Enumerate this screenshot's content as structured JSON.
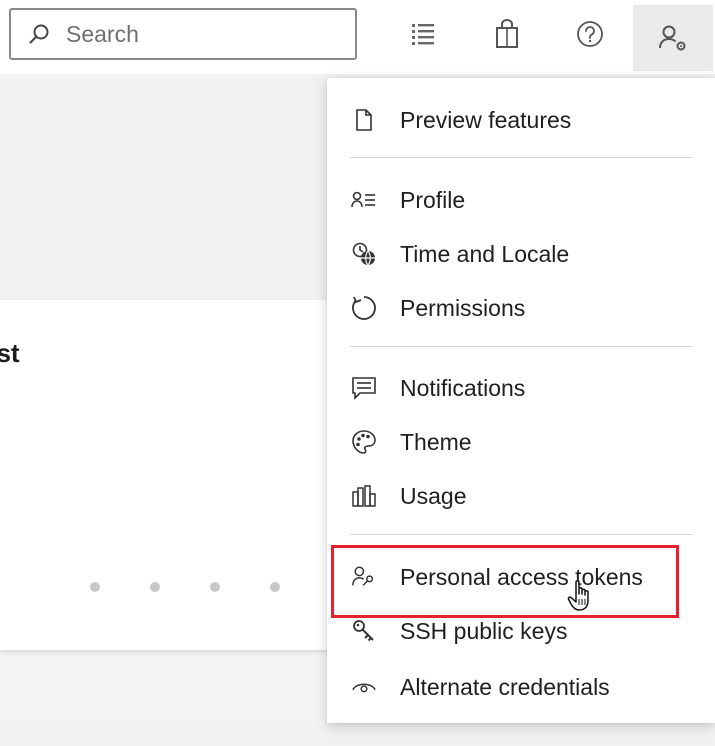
{
  "search": {
    "placeholder": "Search",
    "value": ""
  },
  "header_icons": [
    {
      "name": "list-icon",
      "interactable": true
    },
    {
      "name": "shopping-bag-icon",
      "interactable": true
    },
    {
      "name": "help-icon",
      "interactable": true
    },
    {
      "name": "user-settings-icon",
      "interactable": true
    }
  ],
  "content": {
    "title_fragment": "est",
    "dots": 5
  },
  "menu": {
    "items": [
      {
        "label": "Preview features",
        "icon": "document-icon"
      },
      {
        "label": "Profile",
        "icon": "profile-icon"
      },
      {
        "label": "Time and Locale",
        "icon": "globe-clock-icon"
      },
      {
        "label": "Permissions",
        "icon": "permissions-icon"
      },
      {
        "label": "Notifications",
        "icon": "notifications-icon"
      },
      {
        "label": "Theme",
        "icon": "palette-icon"
      },
      {
        "label": "Usage",
        "icon": "usage-icon"
      },
      {
        "label": "Personal access tokens",
        "icon": "token-user-icon"
      },
      {
        "label": "SSH public keys",
        "icon": "key-icon"
      },
      {
        "label": "Alternate credentials",
        "icon": "eye-icon"
      }
    ]
  },
  "colors": {
    "highlight": "#e8202a",
    "menu_bg": "#ffffff",
    "page_bg": "#f1f1f1",
    "text": "#1f1f1f"
  }
}
